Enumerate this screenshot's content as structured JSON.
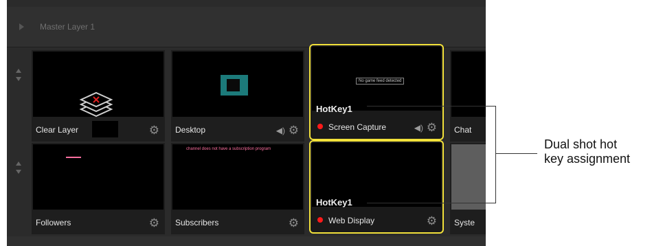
{
  "layer": {
    "title": "Master Layer 1"
  },
  "row1": [
    {
      "label": "Clear Layer"
    },
    {
      "label": "Desktop"
    },
    {
      "label": "Screen Capture",
      "hotkey": "HotKey1",
      "preview_text": "No game feed detected"
    },
    {
      "label": "Chat"
    }
  ],
  "row2": [
    {
      "label": "Followers"
    },
    {
      "label": "Subscribers",
      "preview_text": "channel does not have a subscription program"
    },
    {
      "label": "Web Display",
      "hotkey": "HotKey1"
    },
    {
      "label": "Syste"
    }
  ],
  "callout": {
    "line1": "Dual shot hot",
    "line2": "key assignment"
  },
  "colors": {
    "selected_border": "#f2e13a",
    "live_dot": "#ff1a1a",
    "panel_bg": "#2b2b2b"
  }
}
